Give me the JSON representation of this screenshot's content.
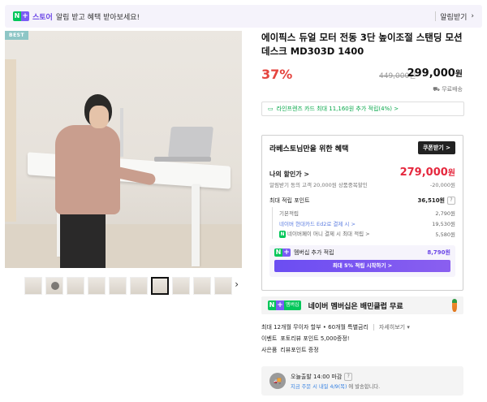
{
  "topbar": {
    "badge_n": "N",
    "badge_plus": "+",
    "store_label": "스토어",
    "message": "알림 받고 혜택 받아보세요!",
    "alert_button": "알림받기",
    "alert_arrow": "›"
  },
  "gallery": {
    "best_badge": "BEST",
    "next_arrow": "›",
    "thumb_count": 10,
    "active_thumb": 6
  },
  "product": {
    "title": "에이픽스 듀얼 모터 전동 3단 높이조절 스탠딩 모션데스크 MD303D 1400",
    "discount": "37%",
    "original_price": "449,000원",
    "sale_price": "299,000",
    "sale_price_unit": "원",
    "shipping": "무료배송",
    "card_point": "라인프렌즈 카드 최대 11,160원 추가 적립(4%) >"
  },
  "benefit": {
    "title": "라베스토님만을 위한 혜택",
    "coupon_button": "쿠폰받기 >",
    "my_discount_label": "나의 할인가 >",
    "my_discount_value": "279,000",
    "my_discount_unit": "원",
    "coupon_note": "알림받기 동의 고객 20,000원 상품중복할인",
    "coupon_amount": "-20,000원",
    "max_points_label": "최대 적립 포인트",
    "max_points_value": "36,510원",
    "help": "?",
    "points": [
      {
        "label": "기본적립",
        "value": "2,790원"
      },
      {
        "label": "네이버 현대카드 Ed2로 결제 시 >",
        "value": "19,530원"
      },
      {
        "label": "네이버페이 머니 결제 시 최대 적립 >",
        "value": "5,580원"
      }
    ],
    "membership_label": "멤버십 추가 적립",
    "membership_value": "8,790원",
    "membership_button": "최대 5% 적립 시작하기 >"
  },
  "promo": {
    "badge": "멤버십",
    "text": "네이버 멤버십은 배민클럽 무료"
  },
  "info_lines": {
    "installment": "최대 12개월 무이자 할부 • 60개월 특별금리",
    "installment_detail": "자세히보기 ▾",
    "event_label": "이벤트",
    "event_value": "포토리뷰 포인트 5,000증정!",
    "gift_label": "사은품",
    "gift_value": "리뷰포인트 증정"
  },
  "delivery": {
    "icon_label": "🚚",
    "title": "오늘출발 14:00 마감",
    "title_q": "?",
    "sub_prefix": "지금 주문 시 내일 4/9(목)",
    "sub_suffix": " 에 발송합니다."
  },
  "colors": {
    "accent_purple": "#6a45e6",
    "naver_green": "#03c75a",
    "sale_red": "#e5453f"
  }
}
